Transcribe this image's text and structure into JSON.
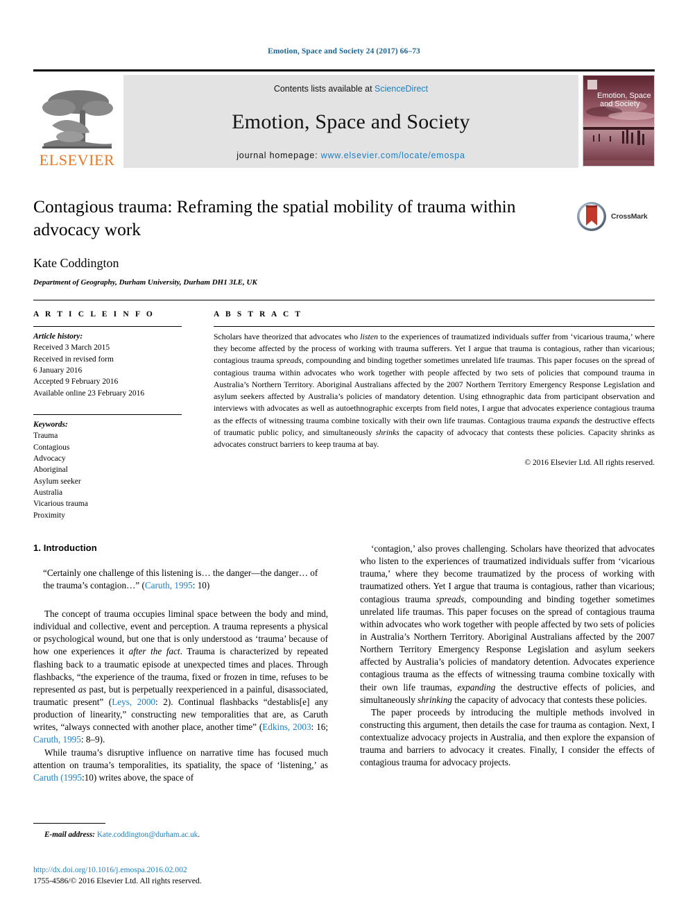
{
  "running_head": "Emotion, Space and Society 24 (2017) 66–73",
  "masthead": {
    "publisher_name": "ELSEVIER",
    "contents_prefix": "Contents lists available at ",
    "contents_link": "ScienceDirect",
    "journal_title": "Emotion, Space and Society",
    "homepage_prefix": "journal homepage: ",
    "homepage_url": "www.elsevier.com/locate/emospa",
    "cover_title_line1": "Emotion, Space",
    "cover_title_line2": "and Society"
  },
  "article": {
    "title": "Contagious trauma: Reframing the spatial mobility of trauma within advocacy work",
    "crossmark_label": "CrossMark",
    "author": "Kate Coddington",
    "affiliation": "Department of Geography, Durham University, Durham DH1 3LE, UK"
  },
  "article_info": {
    "heading": "A R T I C L E   I N F O",
    "history_label": "Article history:",
    "history": [
      "Received 3 March 2015",
      "Received in revised form",
      "6 January 2016",
      "Accepted 9 February 2016",
      "Available online 23 February 2016"
    ],
    "keywords_label": "Keywords:",
    "keywords": [
      "Trauma",
      "Contagious",
      "Advocacy",
      "Aboriginal",
      "Asylum seeker",
      "Australia",
      "Vicarious trauma",
      "Proximity"
    ]
  },
  "abstract": {
    "heading": "A B S T R A C T",
    "text_parts": [
      {
        "t": "Scholars have theorized that advocates who ",
        "i": false
      },
      {
        "t": "listen",
        "i": true
      },
      {
        "t": " to the experiences of traumatized individuals suffer from ‘vicarious trauma,’ where they become affected by the process of working with trauma sufferers. Yet I argue that trauma is contagious, rather than vicarious; contagious trauma ",
        "i": false
      },
      {
        "t": "spreads",
        "i": true
      },
      {
        "t": ", compounding and binding together sometimes unrelated life traumas. This paper focuses on the spread of contagious trauma within advocates who work together with people affected by two sets of policies that compound trauma in Australia’s Northern Territory. Aboriginal Australians affected by the 2007 Northern Territory Emergency Response Legislation and asylum seekers affected by Australia’s policies of mandatory detention. Using ethnographic data from participant observation and interviews with advocates as well as autoethnographic excerpts from field notes, I argue that advocates experience contagious trauma as the effects of witnessing trauma combine toxically with their own life traumas. Contagious trauma ",
        "i": false
      },
      {
        "t": "expands",
        "i": true
      },
      {
        "t": " the destructive effects of traumatic public policy, and simultaneously ",
        "i": false
      },
      {
        "t": "shrinks",
        "i": true
      },
      {
        "t": " the capacity of advocacy that contests these policies. Capacity shrinks as advocates construct barriers to keep trauma at bay.",
        "i": false
      }
    ],
    "copyright": "© 2016 Elsevier Ltd. All rights reserved."
  },
  "body": {
    "section_title": "1. Introduction",
    "epigraph_parts": [
      {
        "t": "“Certainly one challenge of this listening is… the danger—the danger… of the trauma’s contagion…” (",
        "k": "plain"
      },
      {
        "t": "Caruth, 1995",
        "k": "ref"
      },
      {
        "t": ": 10)",
        "k": "plain"
      }
    ],
    "left_paragraphs": [
      [
        {
          "t": "The concept of trauma occupies liminal space between the body and mind, individual and collective, event and perception. A trauma represents a physical or psychological wound, but one that is only understood as ‘trauma’ because of how one experiences it ",
          "k": "plain"
        },
        {
          "t": "after the fact",
          "k": "ital"
        },
        {
          "t": ". Trauma is characterized by repeated flashing back to a traumatic episode at unexpected times and places. Through flashbacks, “the experience of the trauma, fixed or frozen in time, refuses to be represented ",
          "k": "plain"
        },
        {
          "t": "as",
          "k": "ital"
        },
        {
          "t": " past, but is perpetually reexperienced in a painful, disassociated, traumatic present” (",
          "k": "plain"
        },
        {
          "t": "Leys, 2000",
          "k": "ref"
        },
        {
          "t": ": 2). Continual flashbacks “destablis[e] any production of linearity,” constructing new temporalities that are, as Caruth writes, “always connected with another place, another time” (",
          "k": "plain"
        },
        {
          "t": "Edkins, 2003",
          "k": "ref"
        },
        {
          "t": ": 16; ",
          "k": "plain"
        },
        {
          "t": "Caruth, 1995",
          "k": "ref"
        },
        {
          "t": ": 8–9).",
          "k": "plain"
        }
      ],
      [
        {
          "t": "While trauma’s disruptive influence on narrative time has focused much attention on trauma’s temporalities, its spatiality, the space of ‘listening,’ as ",
          "k": "plain"
        },
        {
          "t": "Caruth (1995",
          "k": "ref"
        },
        {
          "t": ":10) writes above, the space of",
          "k": "plain"
        }
      ]
    ],
    "right_paragraphs": [
      [
        {
          "t": "‘contagion,’ also proves challenging. Scholars have theorized that advocates who listen to the experiences of traumatized individuals suffer from ‘vicarious trauma,’ where they become traumatized by the process of working with traumatized others. Yet I argue that trauma is contagious, rather than vicarious; contagious trauma ",
          "k": "plain"
        },
        {
          "t": "spreads",
          "k": "ital"
        },
        {
          "t": ", compounding and binding together sometimes unrelated life traumas. This paper focuses on the spread of contagious trauma within advocates who work together with people affected by two sets of policies in Australia’s Northern Territory. Aboriginal Australians affected by the 2007 Northern Territory Emergency Response Legislation and asylum seekers affected by Australia’s policies of mandatory detention. Advocates experience contagious trauma as the effects of witnessing trauma combine toxically with their own life traumas, ",
          "k": "plain"
        },
        {
          "t": "expanding",
          "k": "ital"
        },
        {
          "t": " the destructive effects of policies, and simultaneously ",
          "k": "plain"
        },
        {
          "t": "shrinking",
          "k": "ital"
        },
        {
          "t": " the capacity of advocacy that contests these policies.",
          "k": "plain"
        }
      ],
      [
        {
          "t": "The paper proceeds by introducing the multiple methods involved in constructing this argument, then details the case for trauma as contagion. Next, I contextualize advocacy projects in Australia, and then explore the expansion of trauma and barriers to advocacy it creates. Finally, I consider the effects of contagious trauma for advocacy projects.",
          "k": "plain"
        }
      ]
    ]
  },
  "footnote": {
    "label": "E-mail address:",
    "email": "Kate.coddington@durham.ac.uk",
    "trailing": "."
  },
  "footer": {
    "doi": "http://dx.doi.org/10.1016/j.emospa.2016.02.002",
    "issn_line": "1755-4586/© 2016 Elsevier Ltd. All rights reserved."
  },
  "colors": {
    "link": "#1a7ec4",
    "running_head": "#1a6496",
    "elsevier_orange": "#E87722",
    "banner_bg": "#e3e3e3"
  }
}
